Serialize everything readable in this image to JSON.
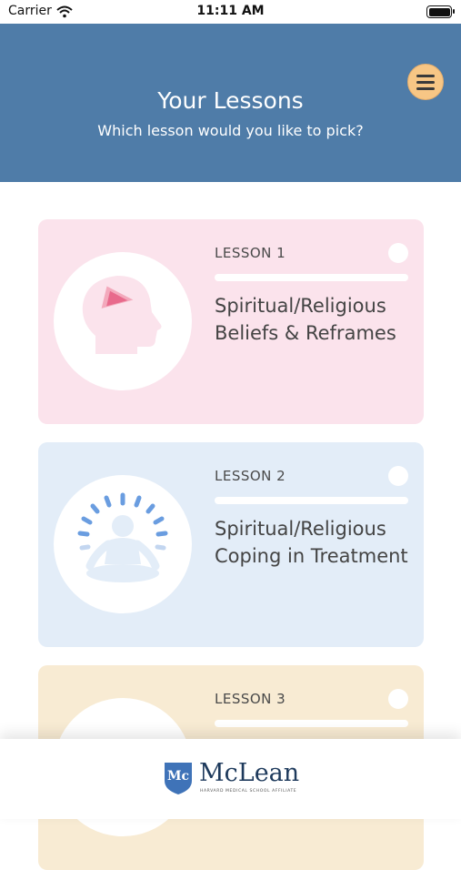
{
  "status_bar": {
    "carrier": "Carrier",
    "time": "11:11 AM"
  },
  "header": {
    "title": "Your Lessons",
    "subtitle": "Which lesson would you like to pick?"
  },
  "lessons": [
    {
      "label": "LESSON 1",
      "title": "Spiritual/Religious Beliefs & Reframes",
      "progress": 0,
      "icon": "head-icon"
    },
    {
      "label": "LESSON 2",
      "title": "Spiritual/Religious Coping in Treatment",
      "progress": 0,
      "icon": "meditation-icon"
    },
    {
      "label": "LESSON 3",
      "title": "",
      "progress": 0,
      "icon": "question-icon"
    }
  ],
  "footer": {
    "logo_text": "McLean",
    "logo_tagline": "HARVARD MEDICAL SCHOOL AFFILIATE"
  },
  "colors": {
    "header": "#4f7ca8",
    "menu_button": "#f7c685",
    "card1": "#fbe3ec",
    "card2": "#e3edf8",
    "card3": "#f8ebd3"
  }
}
